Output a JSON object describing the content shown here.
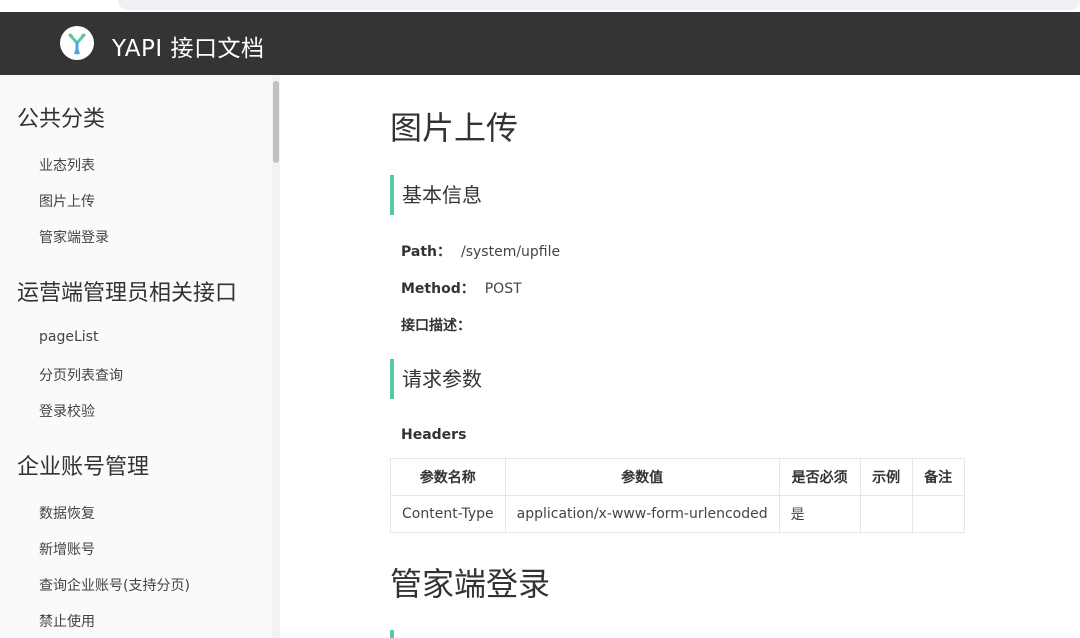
{
  "header": {
    "title": "YAPI 接口文档"
  },
  "sidebar": {
    "categories": [
      {
        "title": "公共分类",
        "items": [
          "业态列表",
          "图片上传",
          "管家端登录"
        ]
      },
      {
        "title": "运营端管理员相关接口",
        "items": [
          "pageList",
          "分页列表查询",
          "登录校验"
        ]
      },
      {
        "title": "企业账号管理",
        "items": [
          "数据恢复",
          "新增账号",
          "查询企业账号(支持分页)",
          "禁止使用"
        ]
      }
    ]
  },
  "main": {
    "api_title": "图片上传",
    "basic_info_heading": "基本信息",
    "path_label": "Path：",
    "path_value": "/system/upfile",
    "method_label": "Method：",
    "method_value": "POST",
    "desc_label": "接口描述：",
    "request_params_heading": "请求参数",
    "headers_label": "Headers",
    "headers_table": {
      "columns": [
        "参数名称",
        "参数值",
        "是否必须",
        "示例",
        "备注"
      ],
      "rows": [
        [
          "Content-Type",
          "application/x-www-form-urlencoded",
          "是",
          "",
          ""
        ]
      ]
    },
    "next_api_title": "管家端登录"
  },
  "colors": {
    "header_bg": "#323436",
    "accent": "#58c9a0"
  }
}
